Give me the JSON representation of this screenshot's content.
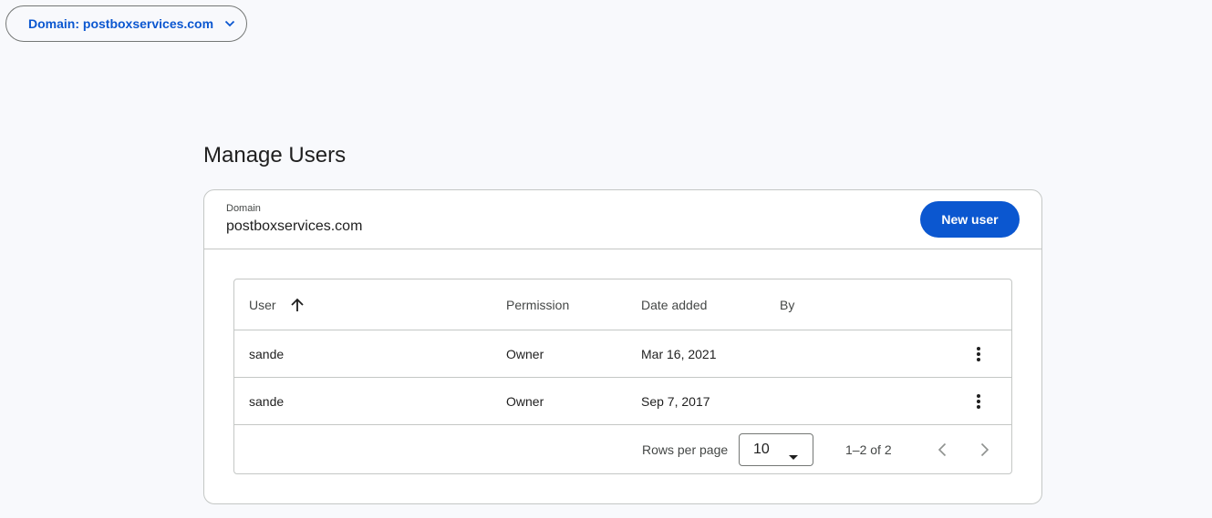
{
  "domain_selector": {
    "label": "Domain: postboxservices.com",
    "icon": "chevron-down-icon"
  },
  "page": {
    "title": "Manage Users"
  },
  "card": {
    "domain_label": "Domain",
    "domain_value": "postboxservices.com",
    "new_user_button": "New user"
  },
  "table": {
    "columns": {
      "user": "User",
      "permission": "Permission",
      "date_added": "Date added",
      "by": "By"
    },
    "sort": {
      "column": "User",
      "direction": "ascending",
      "icon": "arrow-up-icon"
    },
    "rows": [
      {
        "user": "sande",
        "permission": "Owner",
        "date_added": "Mar 16, 2021",
        "by": ""
      },
      {
        "user": "sande",
        "permission": "Owner",
        "date_added": "Sep 7, 2017",
        "by": ""
      }
    ]
  },
  "pagination": {
    "rows_per_page_label": "Rows per page",
    "rows_per_page_value": "10",
    "range": "1–2 of 2"
  },
  "colors": {
    "accent": "#0b57d0",
    "border": "#c4c7c5",
    "background": "#f8f9fc"
  }
}
